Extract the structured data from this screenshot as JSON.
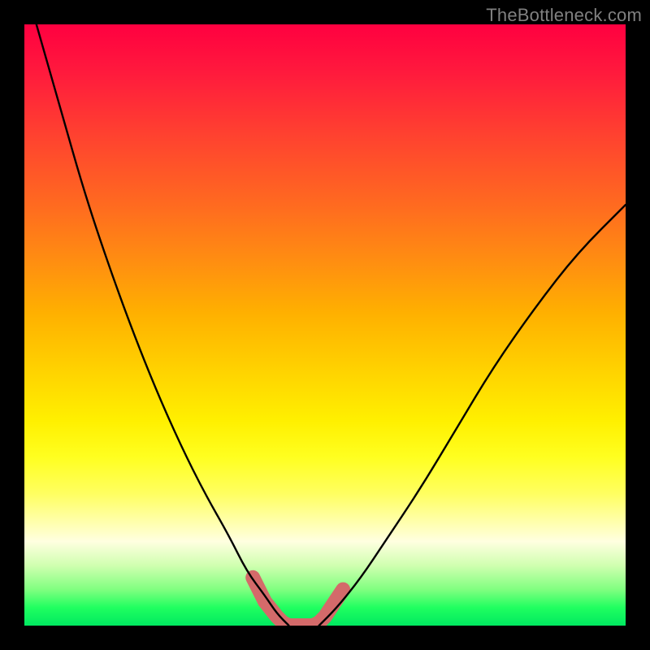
{
  "watermark": "TheBottleneck.com",
  "chart_data": {
    "type": "line",
    "title": "",
    "xlabel": "",
    "ylabel": "",
    "xlim": [
      0,
      100
    ],
    "ylim": [
      0,
      100
    ],
    "grid": false,
    "legend": false,
    "series": [
      {
        "name": "left-curve",
        "x": [
          2,
          6,
          10,
          14,
          18,
          22,
          26,
          30,
          34,
          37,
          40,
          42,
          44
        ],
        "y": [
          100,
          86,
          72,
          60,
          49,
          39,
          30,
          22,
          15,
          9,
          5,
          2,
          0
        ],
        "color": "#000000"
      },
      {
        "name": "right-curve",
        "x": [
          49,
          52,
          56,
          60,
          66,
          72,
          78,
          85,
          92,
          100
        ],
        "y": [
          0,
          3,
          8,
          14,
          23,
          33,
          43,
          53,
          62,
          70
        ],
        "color": "#000000"
      },
      {
        "name": "valley-marker",
        "x": [
          38,
          40,
          42,
          43,
          44,
          46,
          48,
          49,
          50,
          51,
          53
        ],
        "y": [
          8,
          4,
          1.5,
          0.5,
          0,
          0,
          0,
          0.5,
          1.5,
          3,
          6
        ],
        "color": "#d46a6a",
        "marker": "round",
        "linewidth": 14
      }
    ],
    "annotations": []
  }
}
